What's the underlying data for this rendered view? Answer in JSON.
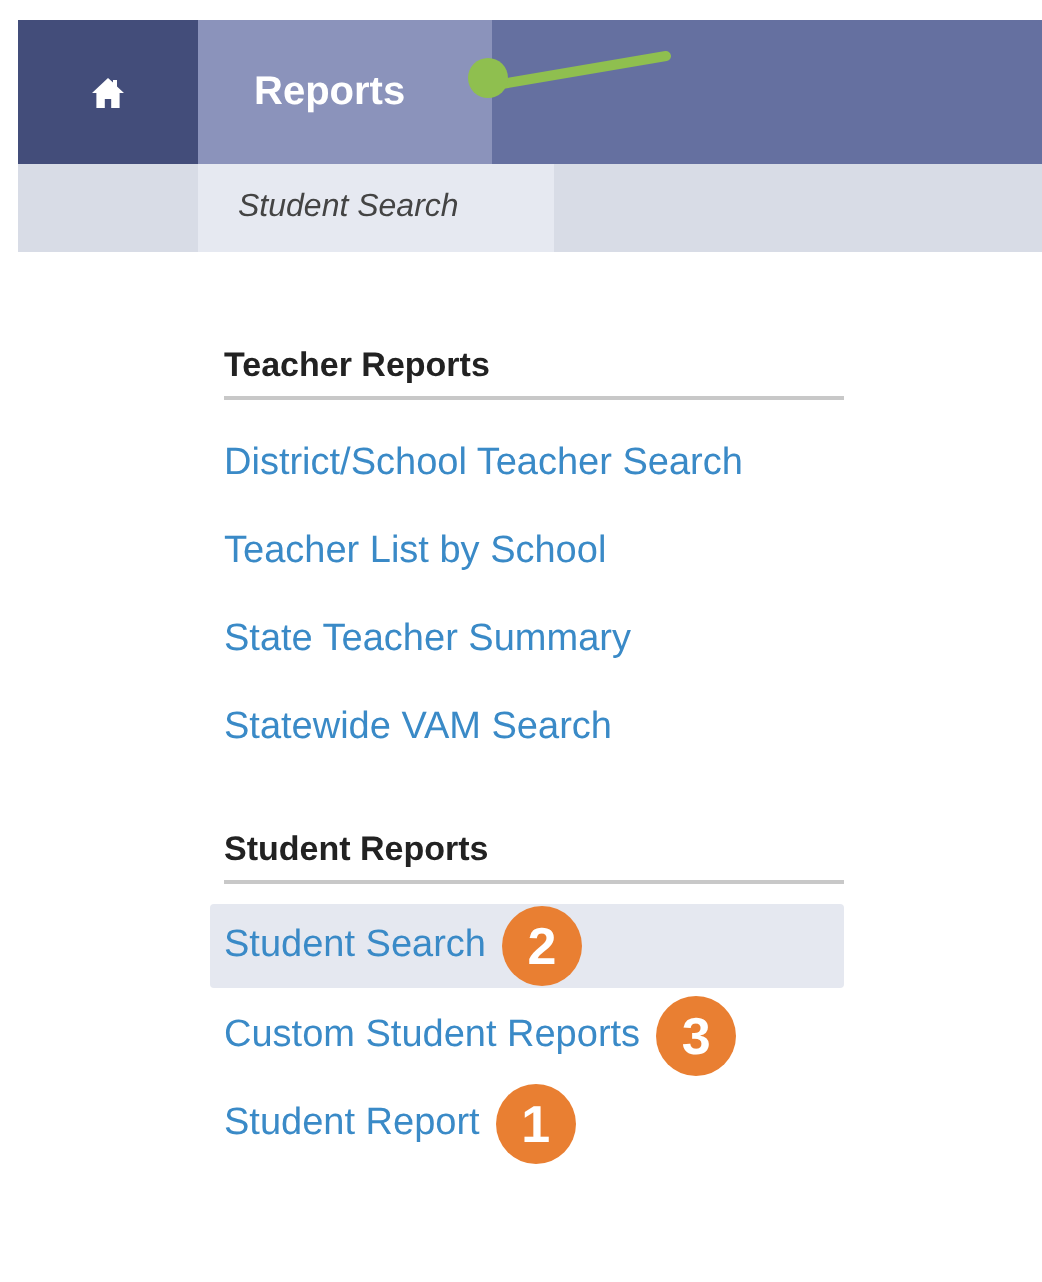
{
  "nav": {
    "tabs": [
      {
        "kind": "home",
        "selected": false
      },
      {
        "kind": "text",
        "label": "Reports",
        "selected": true
      }
    ]
  },
  "subnav": {
    "tabs": [
      {
        "label": "Student Search",
        "selected": true
      }
    ]
  },
  "sections": [
    {
      "heading": "Teacher Reports",
      "links": [
        {
          "label": "District/School Teacher Search",
          "selected": false
        },
        {
          "label": "Teacher List by School",
          "selected": false
        },
        {
          "label": "State Teacher Summary",
          "selected": false
        },
        {
          "label": "Statewide VAM Search",
          "selected": false
        }
      ]
    },
    {
      "heading": "Student Reports",
      "links": [
        {
          "label": "Student Search",
          "selected": true,
          "callout": "2"
        },
        {
          "label": "Custom Student Reports",
          "selected": false,
          "callout": "3"
        },
        {
          "label": "Student Report",
          "selected": false,
          "callout": "1"
        }
      ]
    }
  ]
}
